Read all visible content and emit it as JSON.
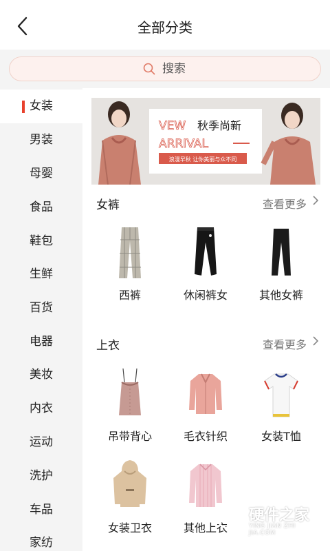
{
  "header": {
    "title": "全部分类"
  },
  "search": {
    "placeholder": "搜索"
  },
  "sidebar": {
    "items": [
      {
        "label": "女装",
        "active": true
      },
      {
        "label": "男装"
      },
      {
        "label": "母婴"
      },
      {
        "label": "食品"
      },
      {
        "label": "鞋包"
      },
      {
        "label": "生鲜"
      },
      {
        "label": "百货"
      },
      {
        "label": "电器"
      },
      {
        "label": "美妆"
      },
      {
        "label": "内衣"
      },
      {
        "label": "运动"
      },
      {
        "label": "洗护"
      },
      {
        "label": "车品"
      },
      {
        "label": "家纺"
      }
    ],
    "active_color": "#e8412d"
  },
  "banner": {
    "headline_left": "VEW",
    "headline_right": "秋季尚新",
    "subheadline": "ARRIVAL",
    "tagline": "浪漫早秋 让你美丽与众不同",
    "accent": "#d95a4b"
  },
  "sections": [
    {
      "title": "女裤",
      "more": "查看更多",
      "items": [
        {
          "label": "西裤",
          "icon": "plaid-trousers-icon"
        },
        {
          "label": "休闲裤女",
          "icon": "black-joggers-icon"
        },
        {
          "label": "其他女裤",
          "icon": "black-pants-icon"
        }
      ]
    },
    {
      "title": "上衣",
      "more": "查看更多",
      "items": [
        {
          "label": "吊带背心",
          "icon": "camisole-icon"
        },
        {
          "label": "毛衣针织",
          "icon": "pink-cardigan-icon"
        },
        {
          "label": "女装T恤",
          "icon": "white-tshirt-icon"
        },
        {
          "label": "女装卫衣",
          "icon": "hoodie-icon"
        },
        {
          "label": "其他上衣",
          "icon": "striped-shirt-icon"
        }
      ]
    }
  ],
  "watermark": {
    "name": "硬件之家",
    "url": "YING JIAN ZHI JIA.COM"
  }
}
